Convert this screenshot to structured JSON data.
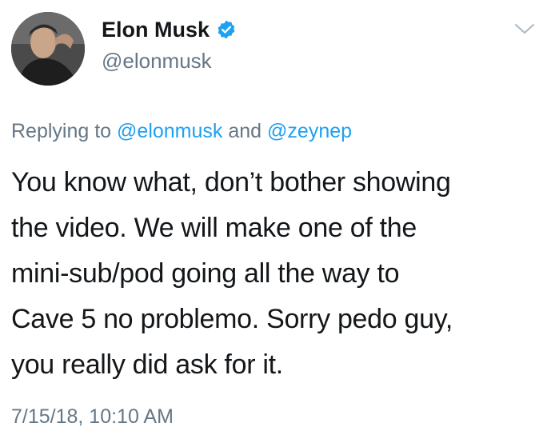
{
  "author": {
    "display_name": "Elon Musk",
    "handle": "@elonmusk",
    "verified": true,
    "avatar_icon": "profile-photo"
  },
  "reply": {
    "prefix": "Replying to",
    "mention1": "@elonmusk",
    "conjunction": "and",
    "mention2": "@zeynep"
  },
  "tweet": {
    "lines": [
      "You know what, don’t bother showing",
      "the video. We will make one of the",
      "mini-sub/pod going all the way to",
      "Cave 5 no problemo. Sorry pedo guy,",
      "you really did ask for it."
    ],
    "timestamp": "7/15/18, 10:10 AM"
  },
  "icons": {
    "verified": "verified-badge-icon",
    "menu": "chevron-down-icon"
  },
  "colors": {
    "text": "#14171a",
    "muted": "#657786",
    "link": "#1da1f2",
    "verified": "#1da1f2"
  }
}
